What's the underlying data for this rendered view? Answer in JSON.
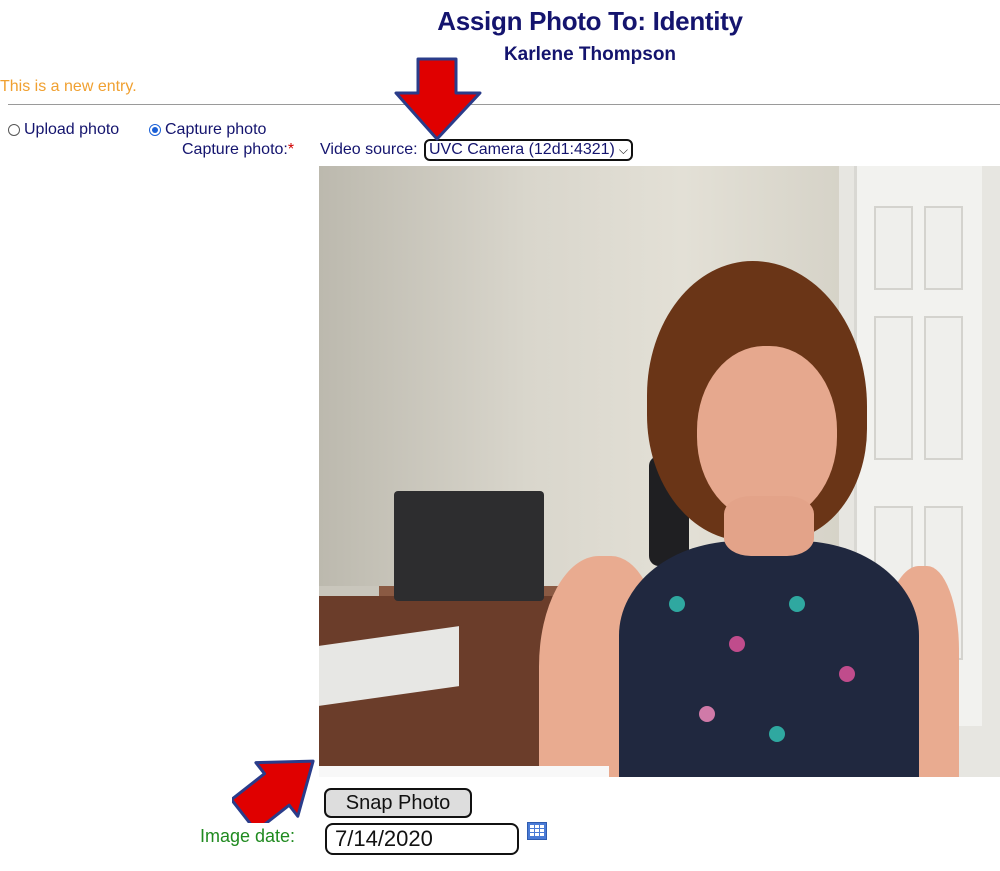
{
  "header": {
    "title": "Assign Photo To: Identity",
    "subtitle": "Karlene Thompson"
  },
  "status": {
    "message": "This is a new entry."
  },
  "photo_mode": {
    "options": [
      {
        "label": "Upload photo",
        "selected": false
      },
      {
        "label": "Capture photo",
        "selected": true
      }
    ]
  },
  "capture": {
    "label": "Capture photo:",
    "required_marker": "*",
    "video_source_label": "Video source:",
    "video_source_value": "UVC Camera (12d1:4321)"
  },
  "actions": {
    "snap_label": "Snap Photo"
  },
  "image_date": {
    "label": "Image date:",
    "value": "7/14/2020"
  },
  "colors": {
    "title": "#14146e",
    "status": "#f0a030",
    "required": "#d00000",
    "date_label": "#1f8a1f",
    "arrow": "#e00000"
  },
  "icons": {
    "calendar": "calendar-icon",
    "dropdown": "chevron-down-icon"
  }
}
